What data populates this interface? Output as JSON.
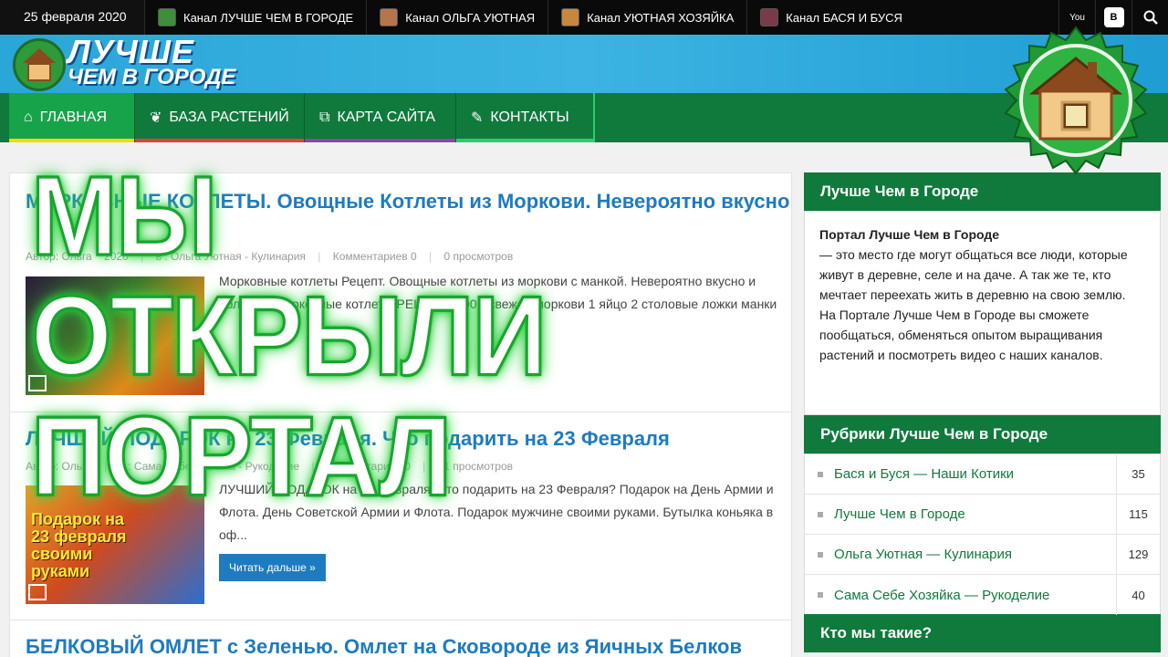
{
  "topbar": {
    "date": "25 февраля 2020",
    "channels": [
      {
        "label": "Канал ЛУЧШЕ ЧЕМ В ГОРОДЕ",
        "color": "#3e8e3a"
      },
      {
        "label": "Канал ОЛЬГА УЮТНАЯ",
        "color": "#b7764a"
      },
      {
        "label": "Канал УЮТНАЯ ХОЗЯЙКА",
        "color": "#c7873e"
      },
      {
        "label": "Канал БАСЯ И БУСЯ",
        "color": "#7a3a4a"
      }
    ],
    "youtube_label": "You",
    "vk_label": "В"
  },
  "logo": {
    "line1": "ЛУЧШЕ",
    "line2": "ЧЕМ В ГОРОДЕ"
  },
  "nav": {
    "items": [
      {
        "label": "ГЛАВНАЯ",
        "icon": "home-icon",
        "glyph": "⌂",
        "bar": "#f5d90a",
        "active": true
      },
      {
        "label": "БАЗА РАСТЕНИЙ",
        "icon": "leaf-icon",
        "glyph": "❦",
        "bar": "#e0433a"
      },
      {
        "label": "КАРТА САЙТА",
        "icon": "sitemap-icon",
        "glyph": "⧉",
        "bar": "#8e44ad"
      },
      {
        "label": "КОНТАКТЫ",
        "icon": "pen-icon",
        "glyph": "✎",
        "bar": "#2ecc71"
      }
    ]
  },
  "posts": [
    {
      "title": "МОРКОВНЫЕ КОТЛЕТЫ. Овощные Котлеты из Моркови. Невероятно вкусно",
      "meta": {
        "author": "Автор: Ольга",
        "date": "2020",
        "category": "в : Ольга Уютная - Кулинария",
        "comments": "Комментариев 0",
        "views": "0 просмотров"
      },
      "excerpt": "Морковные котлеты Рецепт. Овощные котлеты из моркови с манкой. Невероятно вкусно и полезно. Морковные котлеты РЕЦЕПТ: 600 г свежей моркови 1 яйцо 2 столовые ложки манки",
      "readmore": ""
    },
    {
      "title": "ЛУЧШИЙ ПОДАРОК на 23 Февраля. Что подарить на 23 Февраля",
      "meta": {
        "author": "Автор: Ольга",
        "date": "",
        "category": "в : Сама Себе Хозяйка - Рукоделие",
        "comments": "Комментариев 0",
        "views": "21 просмотров"
      },
      "excerpt": "ЛУЧШИЙ ПОДАРОК на 23 Февраля. Что подарить на 23 Февраля? Подарок на День Армии и Флота. День Советской Армии и Флота. Подарок мужчине своими руками. Бутылка коньяка в оф...",
      "thumb_text": "Подарок на 23 февраля своими руками",
      "readmore": "Читать дальше »"
    },
    {
      "title": "БЕЛКОВЫЙ ОМЛЕТ с Зеленью. Омлет на Сковороде из Яичных Белков"
    }
  ],
  "overlay": {
    "line1": "МЫ",
    "line2": "ОТКРЫЛИ",
    "line3": "ПОРТАЛ"
  },
  "sidebar": {
    "about_title": "Лучше Чем в Городе",
    "about_heading": "Портал Лучше Чем в Городе",
    "about_text": "— это место где могут общаться все люди, которые живут в деревне, селе и на даче. А так же те, кто мечтает переехать жить в деревню на свою землю. На Портале Лучше Чем в Городе вы сможете пообщаться, обменяться опытом выращивания растений и посмотреть видео с наших каналов.",
    "categories_title": "Рубрики Лучше Чем в Городе",
    "categories": [
      {
        "name": "Бася и Буся — Наши Котики",
        "count": "35"
      },
      {
        "name": "Лучше Чем в Городе",
        "count": "115"
      },
      {
        "name": "Ольга Уютная — Кулинария",
        "count": "129"
      },
      {
        "name": "Сама Себе Хозяйка — Рукоделие",
        "count": "40"
      }
    ],
    "who_title": "Кто мы такие?"
  },
  "colors": {
    "nav_green": "#0f7a3c",
    "link_blue": "#1e7bbf",
    "overlay_glow": "#2ed33f"
  }
}
